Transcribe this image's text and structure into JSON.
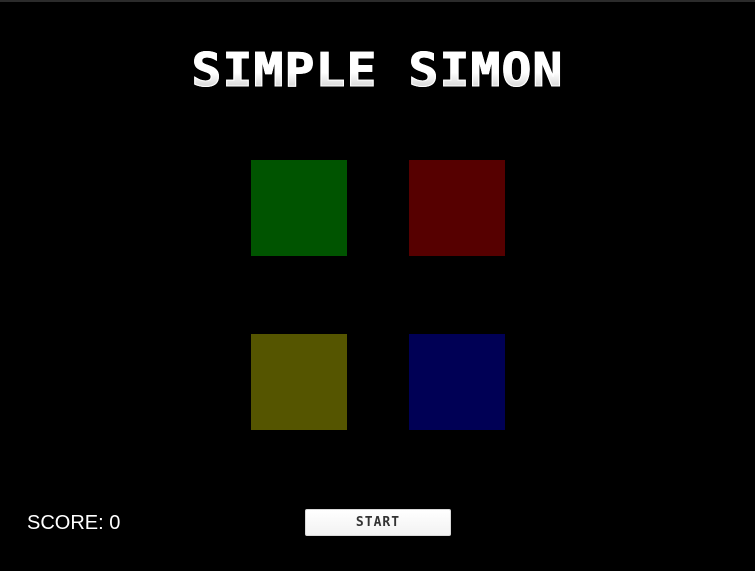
{
  "title": "SIMPLE SIMON",
  "pads": [
    {
      "name": "green",
      "color": "#005400"
    },
    {
      "name": "red",
      "color": "#560000"
    },
    {
      "name": "yellow",
      "color": "#555500"
    },
    {
      "name": "blue",
      "color": "#000055"
    }
  ],
  "score": {
    "label": "SCORE: ",
    "value": "0"
  },
  "start_button": {
    "label": "START"
  },
  "colors": {
    "background": "#000000",
    "text": "#ffffff"
  }
}
